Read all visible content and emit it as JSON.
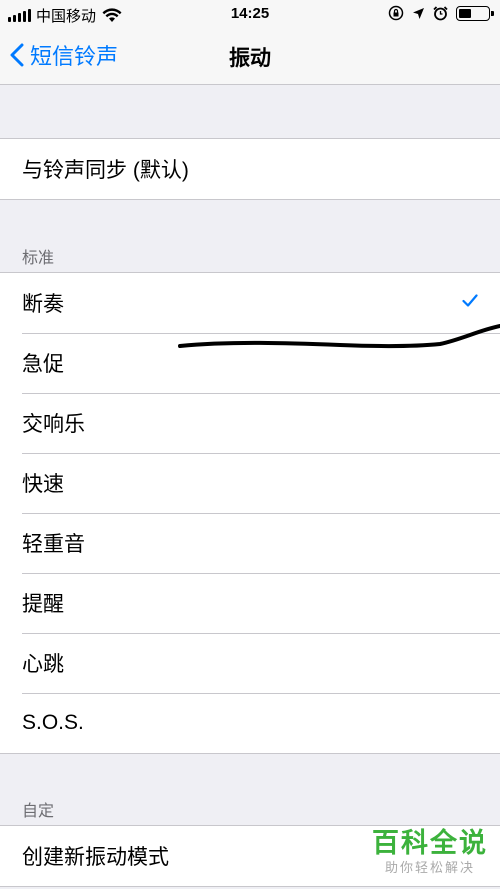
{
  "status_bar": {
    "carrier": "中国移动",
    "time": "14:25",
    "icons": [
      "signal-icon",
      "wifi-icon",
      "orientation-lock-icon",
      "location-icon",
      "alarm-icon",
      "battery-icon"
    ]
  },
  "nav": {
    "back_label": "短信铃声",
    "title": "振动"
  },
  "sync_group": {
    "items": [
      {
        "label": "与铃声同步 (默认)"
      }
    ]
  },
  "standard_section": {
    "header": "标准",
    "items": [
      {
        "label": "断奏",
        "selected": true
      },
      {
        "label": "急促"
      },
      {
        "label": "交响乐"
      },
      {
        "label": "快速"
      },
      {
        "label": "轻重音"
      },
      {
        "label": "提醒"
      },
      {
        "label": "心跳"
      },
      {
        "label": "S.O.S."
      }
    ]
  },
  "custom_section": {
    "header": "自定",
    "items": [
      {
        "label": "创建新振动模式"
      }
    ]
  },
  "watermark": {
    "title": "百科全说",
    "subtitle": "助你轻松解决"
  },
  "colors": {
    "accent": "#007aff",
    "background": "#efeff4",
    "separator": "#c8c7cc",
    "section_header": "#6d6d72",
    "watermark_green": "#3cb23c"
  }
}
